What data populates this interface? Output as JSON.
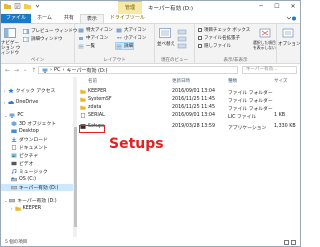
{
  "titlebar": {
    "manage_label": "管理",
    "title": "キーパー有効 (D:)",
    "controls": [
      "─",
      "☐",
      "✕"
    ]
  },
  "tabs": [
    {
      "label": "ファイル"
    },
    {
      "label": "ホーム"
    },
    {
      "label": "共有"
    },
    {
      "label": "表示"
    },
    {
      "label": "ドライブツール"
    }
  ],
  "ribbon": {
    "pane_group": {
      "label": "ペイン",
      "nav_pane": "ナビゲーション ウィンドウ",
      "preview": "プレビュー ウィンドウ",
      "details": "詳細ウィンドウ"
    },
    "layout_group": {
      "label": "レイアウト",
      "items": [
        "特大アイコン",
        "大アイコン",
        "中アイコン",
        "小アイコン",
        "一覧",
        "詳細"
      ]
    },
    "current_view_group": {
      "label": "現在のビュー",
      "sort": "並べ替え"
    },
    "show_hide_group": {
      "label": "表示/非表示",
      "checkbox_items": [
        "項目チェック ボックス",
        "ファイル名拡張子",
        "隠しファイル"
      ],
      "hide_selected": "選択した項目を表示しない"
    },
    "options_label": "オプション"
  },
  "address": {
    "path": [
      "PC",
      "キーパー有効 (D:)"
    ],
    "search_placeholder": "キーパー有効..."
  },
  "sidebar": {
    "items": [
      {
        "label": "クイック アクセス",
        "icon": "star-icon"
      },
      {
        "label": "OneDrive",
        "icon": "cloud-icon"
      },
      {
        "label": "PC",
        "icon": "pc-icon"
      },
      {
        "label": "3D オブジェクト",
        "icon": "cube-icon"
      },
      {
        "label": "Desktop",
        "icon": "desktop-icon"
      },
      {
        "label": "ダウンロード",
        "icon": "download-icon"
      },
      {
        "label": "ドキュメント",
        "icon": "document-icon"
      },
      {
        "label": "ピクチャ",
        "icon": "picture-icon"
      },
      {
        "label": "ビデオ",
        "icon": "video-icon"
      },
      {
        "label": "ミュージック",
        "icon": "music-icon"
      },
      {
        "label": "OS (C:)",
        "icon": "drive-icon"
      },
      {
        "label": "キーパー有効 (D:)",
        "icon": "drive-icon"
      },
      {
        "label": "キーパー有効 (D:)",
        "icon": "drive-icon"
      },
      {
        "label": "KEEPER",
        "icon": "folder-icon"
      }
    ]
  },
  "columns": {
    "name": "名前",
    "date": "更新日時",
    "type": "種類",
    "size": "サイズ"
  },
  "files": [
    {
      "name": "KEEPER",
      "date": "2016/09/01 13:04",
      "type": "ファイル フォルダー",
      "size": "",
      "icon": "folder-icon"
    },
    {
      "name": "SystemSF",
      "date": "2016/11/25 11:45",
      "type": "ファイル フォルダー",
      "size": "",
      "icon": "folder-icon"
    },
    {
      "name": "zdata",
      "date": "2016/11/25 11:45",
      "type": "ファイル フォルダー",
      "size": "",
      "icon": "folder-icon"
    },
    {
      "name": "SERIAL",
      "date": "2016/09/01 13:04",
      "type": "LIC ファイル",
      "size": "1 KB",
      "icon": "file-icon"
    },
    {
      "name": "Setups",
      "date": "2019/03/28 13:59",
      "type": "アプリケーション",
      "size": "1,330 KB",
      "icon": "app-icon"
    }
  ],
  "annotation": "Setups",
  "status": {
    "count": "5 個の項目"
  },
  "colors": {
    "accent": "#1979ca",
    "highlight": "#e52020",
    "selection": "#cce8ff"
  }
}
